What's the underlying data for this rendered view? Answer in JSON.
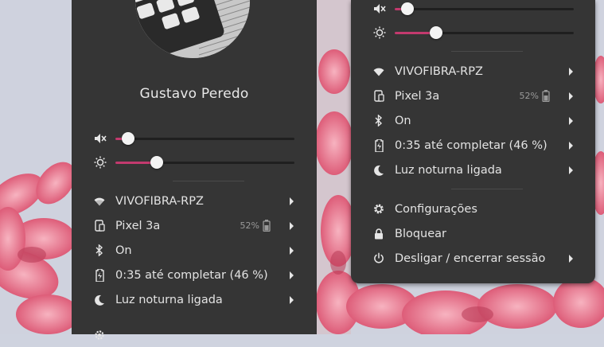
{
  "user": {
    "name": "Gustavo Peredo"
  },
  "menu_items": {
    "wifi": "VIVOFIBRA-RPZ",
    "device": "Pixel 3a",
    "device_battery": "52%",
    "bluetooth": "On",
    "battery": "0:35 até completar (46 %)",
    "night_light": "Luz noturna ligada",
    "settings": "Configurações",
    "lock": "Bloquear",
    "power": "Desligar / encerrar sessão"
  },
  "sliders": {
    "volume_level": 0.07,
    "brightness_level": 0.23
  },
  "colors": {
    "panel_bg": "#353535",
    "accent": "#c33a6e",
    "text": "#e3e3e3"
  },
  "icons": [
    "wifi-icon",
    "phone-icon",
    "bluetooth-icon",
    "battery-charging-icon",
    "night-light-icon",
    "gear-icon",
    "lock-icon",
    "power-icon",
    "volume-muted-icon",
    "brightness-icon",
    "chevron-right-icon"
  ]
}
